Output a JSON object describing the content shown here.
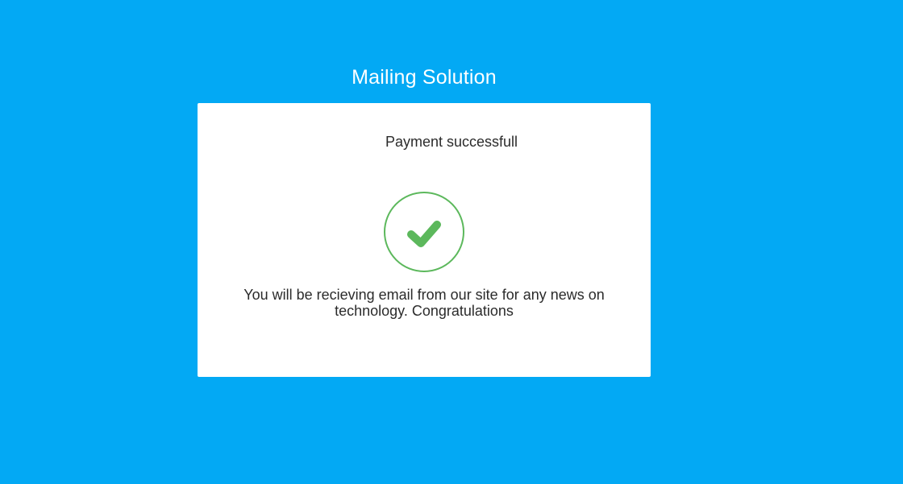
{
  "header": {
    "title": "Mailing Solution"
  },
  "card": {
    "heading": "Payment successfull",
    "status_icon": "checkmark-circle-icon",
    "message": "You will be recieving email from our site for any news on technology. Congratulations"
  },
  "colors": {
    "background": "#03a9f4",
    "card": "#ffffff",
    "success": "#5cb85c",
    "text": "#2b2b2b"
  }
}
